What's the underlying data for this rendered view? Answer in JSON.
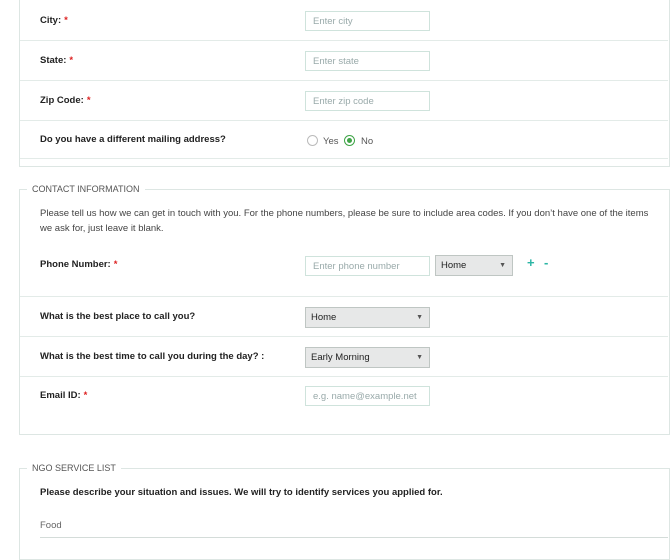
{
  "address": {
    "city": {
      "label": "City:",
      "required": "*",
      "placeholder": "Enter city"
    },
    "state": {
      "label": "State:",
      "required": "*",
      "placeholder": "Enter state"
    },
    "zip": {
      "label": "Zip Code:",
      "required": "*",
      "placeholder": "Enter zip code"
    },
    "mailing": {
      "label": "Do you have a different mailing address?",
      "options": [
        "Yes",
        "No"
      ],
      "selected": "No"
    }
  },
  "contact": {
    "legend": "CONTACT INFORMATION",
    "description": "Please tell us how we can get in touch with you. For the phone numbers, please be sure to include area codes. If you don’t have one of the items we ask for, just leave it blank.",
    "phone": {
      "label": "Phone Number:",
      "required": "*",
      "placeholder": "Enter phone number",
      "type_value": "Home",
      "add": "+",
      "remove": "-"
    },
    "best_place": {
      "label": "What is the best place to call you?",
      "value": "Home"
    },
    "best_time": {
      "label": "What is the best time to call you during the day? :",
      "value": "Early Morning"
    },
    "email": {
      "label": "Email ID:",
      "required": "*",
      "placeholder": "e.g. name@example.net"
    }
  },
  "ngo": {
    "legend": "NGO SERVICE LIST",
    "heading": "Please describe your situation and issues. We will try to identify services you applied for.",
    "first_item": "Food"
  },
  "colors": {
    "accent": "#2bb5a5",
    "required": "#d22222",
    "radio_on": "#3fa447"
  },
  "icons": {
    "dropdown": "caret-down-icon"
  }
}
